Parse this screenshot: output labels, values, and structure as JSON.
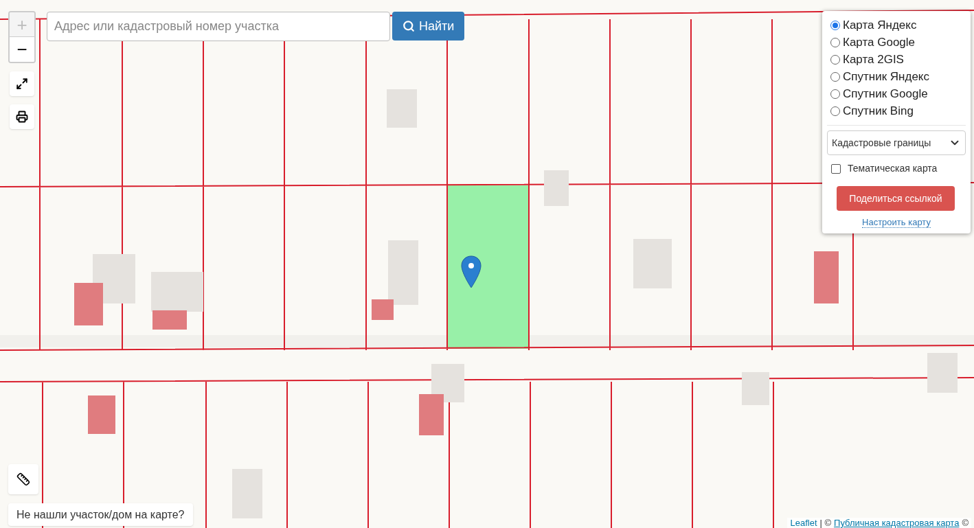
{
  "zoom_controls": [
    {
      "label": "+",
      "disabled": true
    },
    {
      "label": "−",
      "disabled": false
    }
  ],
  "search": {
    "placeholder": "Адрес или кадастровый номер участка",
    "button": "Найти"
  },
  "layers": [
    {
      "label": "Карта Яндекс",
      "selected": true
    },
    {
      "label": "Карта Google",
      "selected": false
    },
    {
      "label": "Карта 2GIS",
      "selected": false
    },
    {
      "label": "Спутник Яндекс",
      "selected": false
    },
    {
      "label": "Спутник Google",
      "selected": false
    },
    {
      "label": "Спутник Bing",
      "selected": false
    }
  ],
  "overlay_select": {
    "value": "Кадастровые границы"
  },
  "thematic": {
    "label": "Тематическая карта",
    "checked": false
  },
  "share_button": "Поделиться ссылкой",
  "configure_link": "Настроить карту",
  "not_found_button": "Не нашли участок/дом на карте?",
  "attribution": {
    "link_1": "Leaflet",
    "separator": "| ©",
    "link_2": "Публичная кадастровая карта",
    "suffix": "©"
  }
}
